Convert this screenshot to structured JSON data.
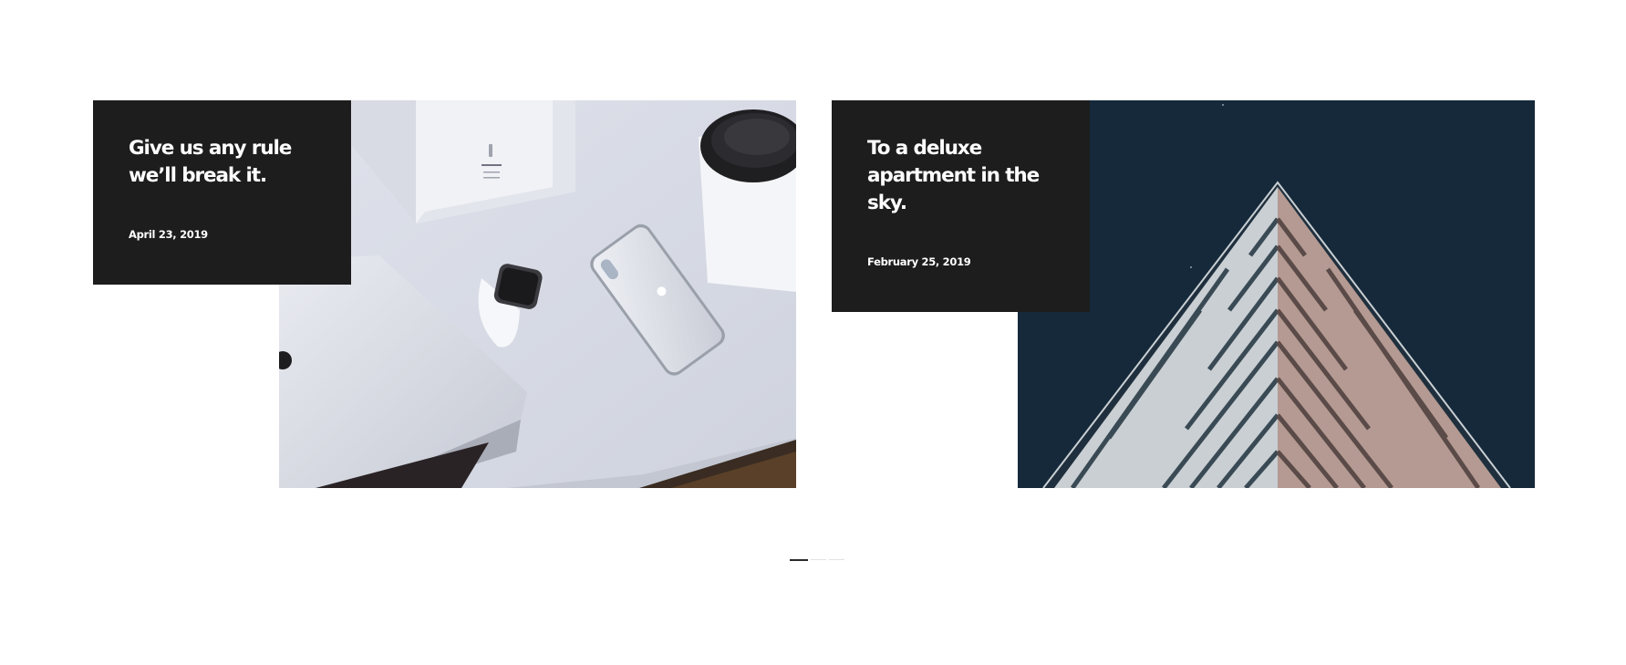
{
  "posts": [
    {
      "title_line1": "Give us any rule",
      "title_line2": "we’ll break it.",
      "title_line3": "",
      "date": "April 23, 2019",
      "image": "desk-devices-photo"
    },
    {
      "title_line1": "To a deluxe",
      "title_line2": "apartment in the",
      "title_line3": "sky.",
      "date": "February 25, 2019",
      "image": "skyscraper-triangle-photo"
    }
  ],
  "pager": {
    "active_index": 0,
    "dot_count": 3
  },
  "colors": {
    "overlay": "#1d1d1d",
    "sky": "#15293a",
    "pager_active": "#2a2a2a",
    "pager_inactive": "#e2e2e2"
  }
}
